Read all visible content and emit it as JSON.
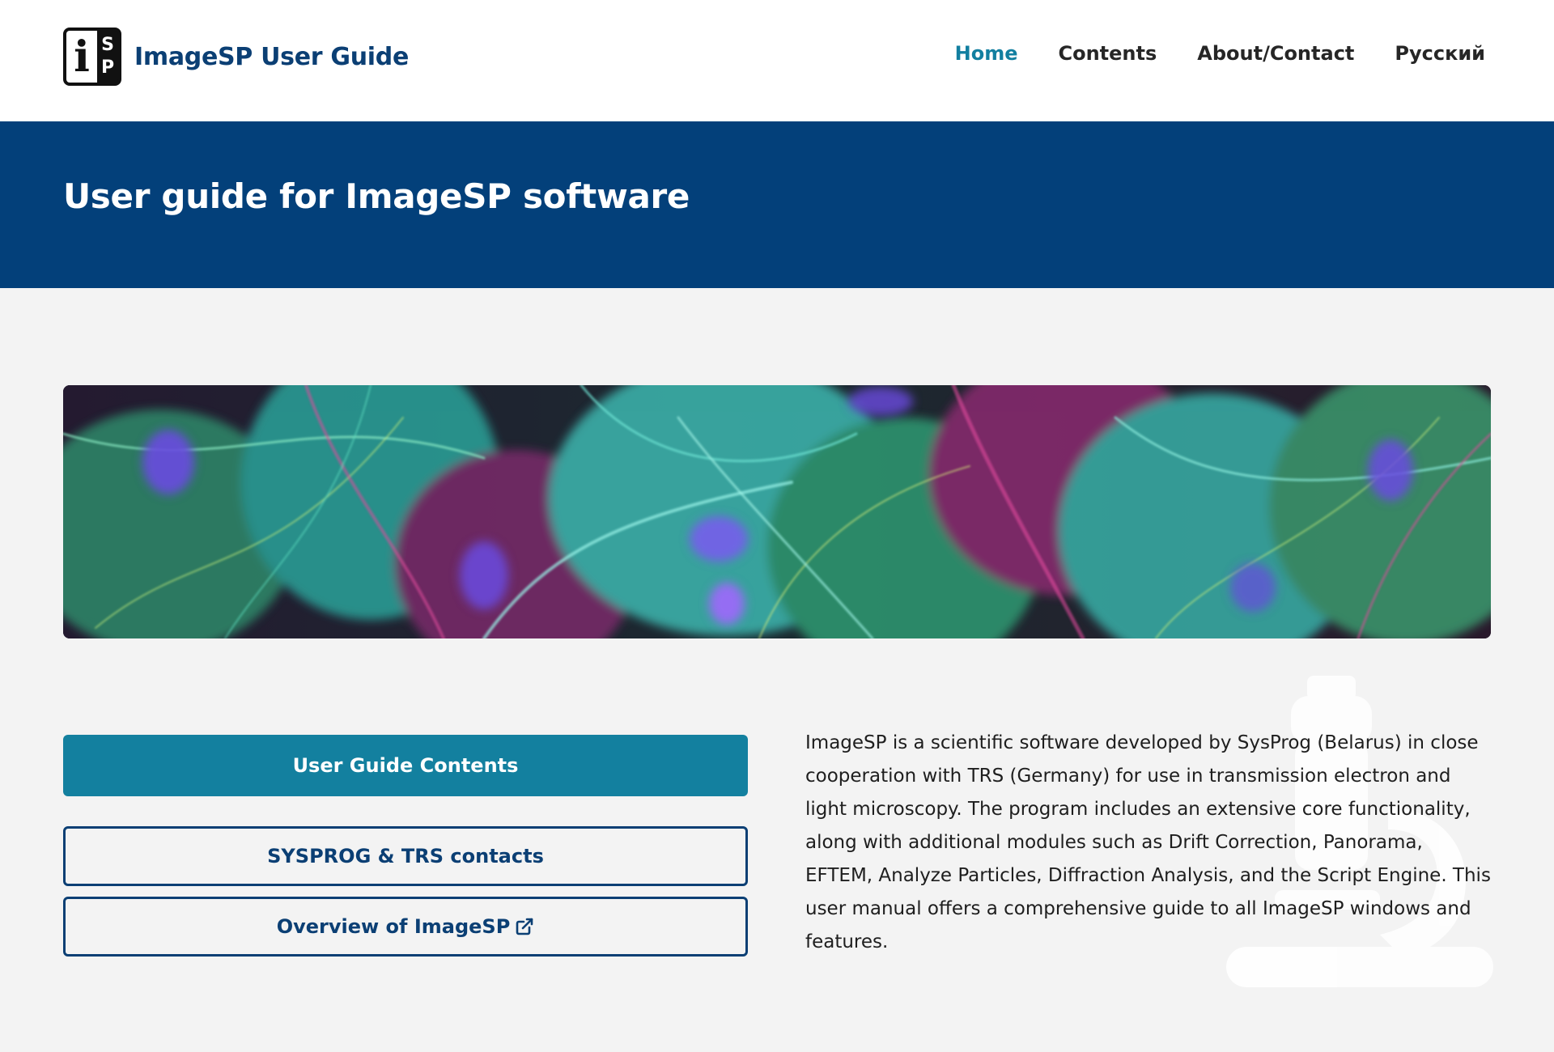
{
  "header": {
    "logo": {
      "letter_main": "i",
      "letter_top": "S",
      "letter_bottom": "P"
    },
    "site_title": "ImageSP User Guide",
    "nav": [
      {
        "label": "Home",
        "active": true
      },
      {
        "label": "Contents",
        "active": false
      },
      {
        "label": "About/Contact",
        "active": false
      },
      {
        "label": "Русский",
        "active": false
      }
    ]
  },
  "banner": {
    "title": "User guide for ImageSP software"
  },
  "buttons": {
    "contents": "User Guide Contents",
    "contacts": "SYSPROG & TRS contacts",
    "overview": "Overview of ImageSP"
  },
  "description": "ImageSP is a scientific software developed by SysProg (Belarus) in close cooperation with TRS (Germany) for use in transmission electron and light microscopy. The program includes an extensive core functionality, along with additional modules such as Drift Correction, Panorama, EFTEM, Analyze Particles, Diffraction Analysis, and the Script Engine. This user manual offers a comprehensive guide to all ImageSP windows and features.",
  "colors": {
    "brand_navy": "#03407a",
    "accent_teal": "#13809f",
    "page_bg": "#f3f3f3"
  },
  "icons": {
    "external_link": "external-link-icon",
    "watermark": "microscope-icon"
  }
}
